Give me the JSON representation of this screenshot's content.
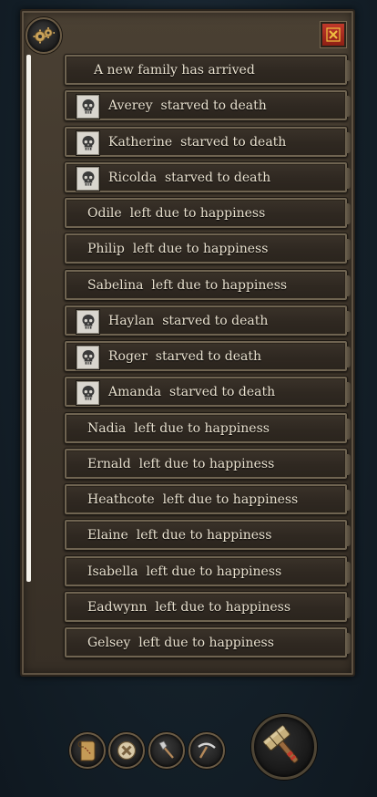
{
  "panel": {
    "close_icon": "close-x-icon",
    "settings_icon": "gears-icon"
  },
  "events": [
    {
      "text": "A new family has arrived",
      "icon": null,
      "type": "header"
    },
    {
      "text": "Averey  starved to death",
      "icon": "skull-icon",
      "type": "starved"
    },
    {
      "text": "Katherine  starved to death",
      "icon": "skull-icon",
      "type": "starved"
    },
    {
      "text": "Ricolda  starved to death",
      "icon": "skull-icon",
      "type": "starved"
    },
    {
      "text": "Odile  left due to happiness",
      "icon": null,
      "type": "left"
    },
    {
      "text": "Philip  left due to happiness",
      "icon": null,
      "type": "left"
    },
    {
      "text": "Sabelina  left due to happiness",
      "icon": null,
      "type": "left"
    },
    {
      "text": "Haylan  starved to death",
      "icon": "skull-icon",
      "type": "starved"
    },
    {
      "text": "Roger  starved to death",
      "icon": "skull-icon",
      "type": "starved"
    },
    {
      "text": "Amanda  starved to death",
      "icon": "skull-icon",
      "type": "starved"
    },
    {
      "text": "Nadia  left due to happiness",
      "icon": null,
      "type": "left"
    },
    {
      "text": "Ernald  left due to happiness",
      "icon": null,
      "type": "left"
    },
    {
      "text": "Heathcote  left due to happiness",
      "icon": null,
      "type": "left"
    },
    {
      "text": "Elaine  left due to happiness",
      "icon": null,
      "type": "left"
    },
    {
      "text": "Isabella  left due to happiness",
      "icon": null,
      "type": "left"
    },
    {
      "text": "Eadwynn  left due to happiness",
      "icon": null,
      "type": "left"
    },
    {
      "text": "Gelsey  left due to happiness",
      "icon": null,
      "type": "left"
    }
  ],
  "toolbar": {
    "buttons": [
      {
        "name": "map-scroll-button",
        "icon": "scroll-map-icon"
      },
      {
        "name": "cancel-demolish-button",
        "icon": "cancel-circle-icon"
      },
      {
        "name": "axe-button",
        "icon": "axe-icon"
      },
      {
        "name": "pickaxe-button",
        "icon": "pickaxe-icon"
      }
    ],
    "build_button_icon": "hammer-icon"
  },
  "colors": {
    "panel": "#3f362b",
    "row_border": "#6f6451",
    "text": "#e9e1cf",
    "close": "#c0392b",
    "background": "#15202a"
  }
}
